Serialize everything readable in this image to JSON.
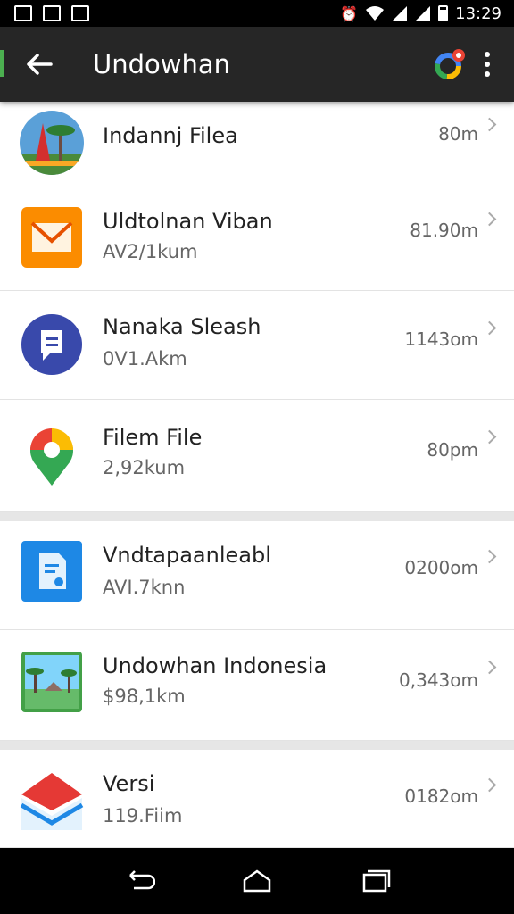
{
  "status_bar": {
    "time": "13:29"
  },
  "app_bar": {
    "title": "Undowhan"
  },
  "items": [
    {
      "title": "Indannj Filea",
      "subtitle": "",
      "distance": "80m",
      "icon": "landmark-photo-icon"
    },
    {
      "title": "Uldtolnan Viban",
      "subtitle": "AV2/1kum",
      "distance": "81.90m",
      "icon": "mail-icon"
    },
    {
      "title": "Nanaka Sleash",
      "subtitle": "0V1.Akm",
      "distance": "1143om",
      "icon": "chat-icon"
    },
    {
      "title": "Filem File",
      "subtitle": "2,92kum",
      "distance": "80pm",
      "icon": "map-pin-icon"
    },
    {
      "title": "Vndtapaanleabl",
      "subtitle": "AVI.7knn",
      "distance": "0200om",
      "icon": "document-icon"
    },
    {
      "title": "Undowhan Indonesia",
      "subtitle": "$98,1km",
      "distance": "0,343om",
      "icon": "island-photo-icon"
    },
    {
      "title": "Versi",
      "subtitle": "119.Fiim",
      "distance": "0182om",
      "icon": "inbox-icon"
    }
  ]
}
